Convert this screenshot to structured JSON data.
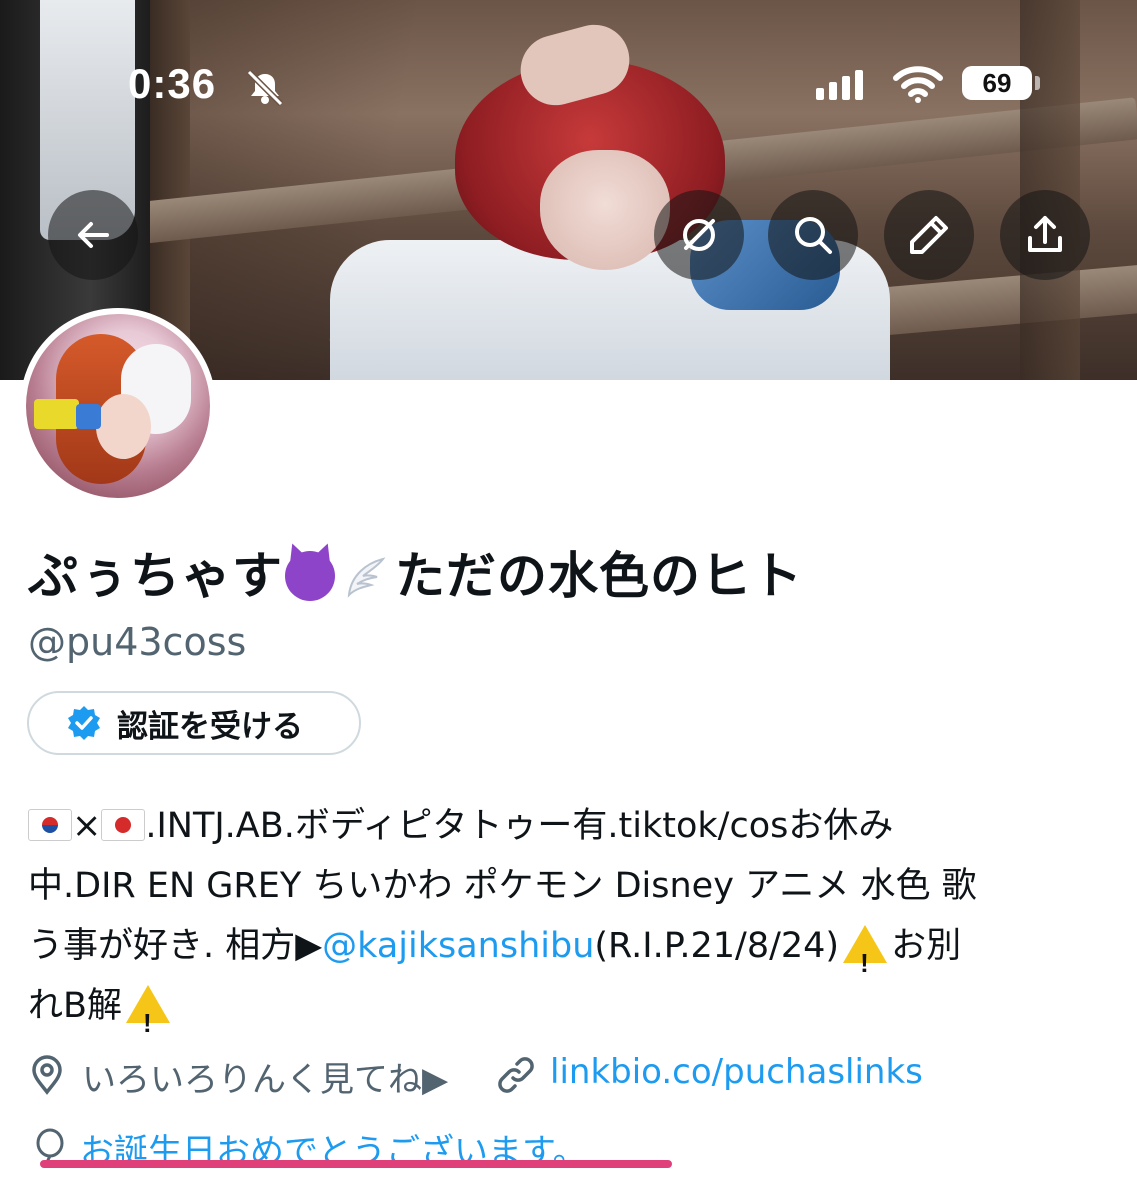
{
  "status_bar": {
    "time": "0:36",
    "battery": "69"
  },
  "nav": {
    "back_icon": "arrow-left-icon",
    "grok_icon": "grok-icon",
    "search_icon": "search-icon",
    "edit_icon": "pencil-icon",
    "share_icon": "share-icon"
  },
  "profile": {
    "name_part1": "ぷぅちゃす",
    "name_part2": "ただの水色のヒト",
    "handle": "@pu43coss",
    "verify_button": "認証を受ける"
  },
  "bio": {
    "line1_text": ".INTJ.AB.ボディピタトゥー有.tiktok/cosお休み",
    "line2": "中.DIR EN GREY ちいかわ ポケモン Disney アニメ 水色 歌",
    "line3_before": "う事が好き. 相方▶",
    "line3_mention": "@kajiksanshibu",
    "line3_after": "(R.I.P.21/8/24)",
    "line3_end": "お別",
    "line4": "れB解",
    "times_symbol": "×"
  },
  "meta": {
    "location": "いろいろりんく見てね▶",
    "link": "linkbio.co/puchaslinks",
    "birthday": "お誕生日おめでとうございます。"
  },
  "colors": {
    "accent": "#1d9bf0",
    "underline": "#e0407a",
    "muted": "#536471"
  }
}
